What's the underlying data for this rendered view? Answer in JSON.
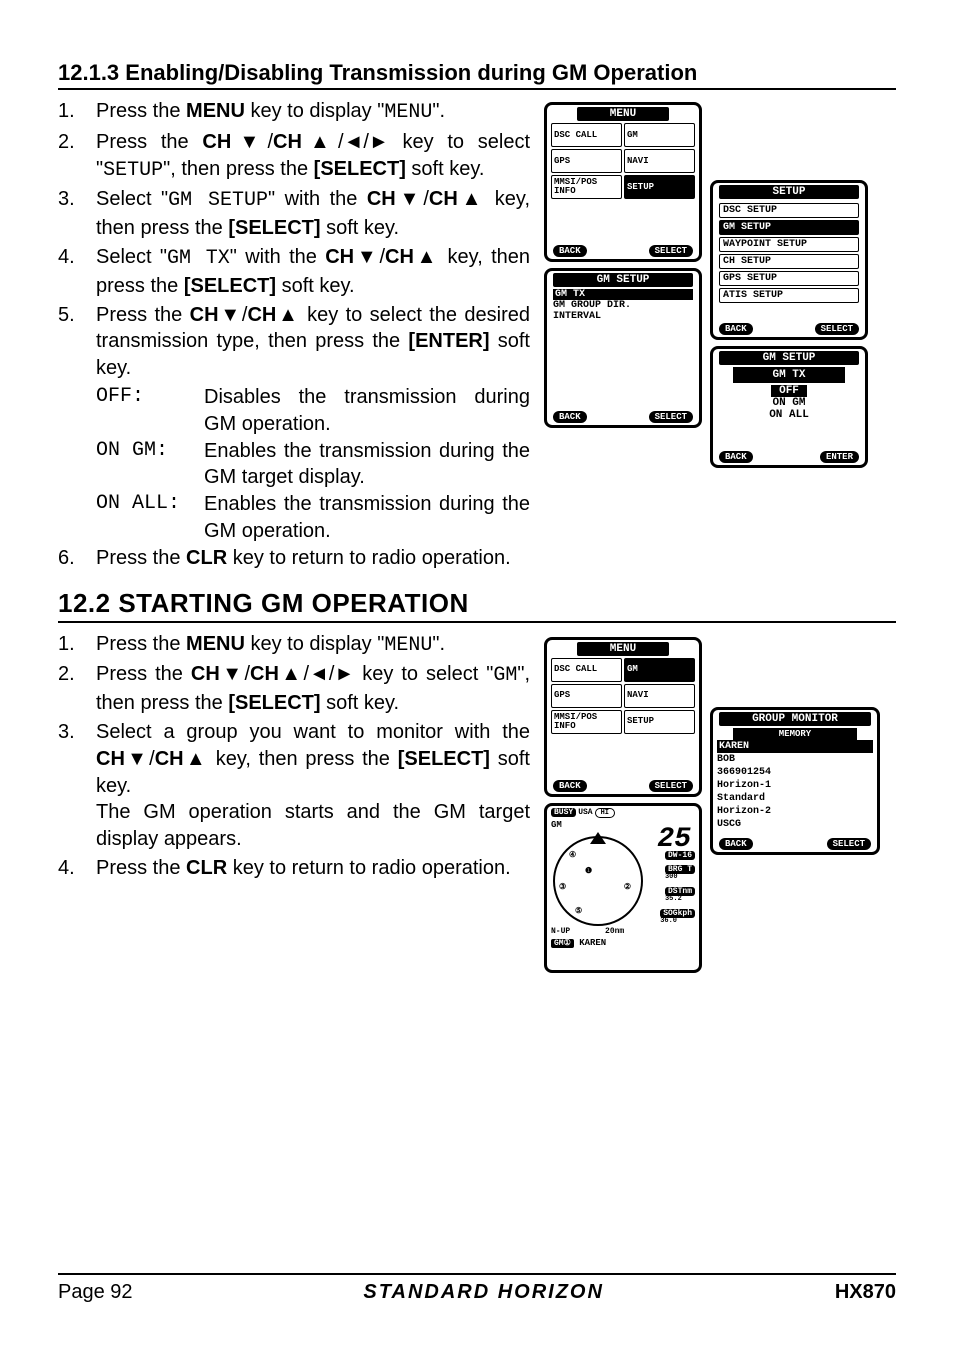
{
  "section1": {
    "heading": "12.1.3  Enabling/Disabling Transmission during GM Operation",
    "steps": [
      {
        "num": "1.",
        "segments": [
          {
            "t": "Press the "
          },
          {
            "t": "MENU",
            "b": true
          },
          {
            "t": " key to display \""
          },
          {
            "t": "MENU",
            "m": true
          },
          {
            "t": "\"."
          }
        ]
      },
      {
        "num": "2.",
        "segments": [
          {
            "t": "Press the "
          },
          {
            "t": "CH▼",
            "b": true
          },
          {
            "t": "/"
          },
          {
            "t": "CH▲",
            "b": true
          },
          {
            "t": "/"
          },
          {
            "t": "◄",
            "b": true
          },
          {
            "t": "/"
          },
          {
            "t": "►",
            "b": true
          },
          {
            "t": " key to select \""
          },
          {
            "t": "SETUP",
            "m": true
          },
          {
            "t": "\", then press the "
          },
          {
            "t": "[SELECT]",
            "b": true
          },
          {
            "t": " soft key."
          }
        ]
      },
      {
        "num": "3.",
        "segments": [
          {
            "t": "Select \""
          },
          {
            "t": "GM SETUP",
            "m": true
          },
          {
            "t": "\" with the "
          },
          {
            "t": "CH▼",
            "b": true
          },
          {
            "t": "/"
          },
          {
            "t": "CH▲",
            "b": true
          },
          {
            "t": " key, then press the "
          },
          {
            "t": "[SELECT]",
            "b": true
          },
          {
            "t": " soft key."
          }
        ]
      },
      {
        "num": "4.",
        "segments": [
          {
            "t": "Select \""
          },
          {
            "t": "GM TX",
            "m": true
          },
          {
            "t": "\" with the "
          },
          {
            "t": "CH▼",
            "b": true
          },
          {
            "t": "/"
          },
          {
            "t": "CH▲",
            "b": true
          },
          {
            "t": " key, then press the "
          },
          {
            "t": "[SELECT]",
            "b": true
          },
          {
            "t": " soft key."
          }
        ]
      },
      {
        "num": "5.",
        "segments": [
          {
            "t": "Press the "
          },
          {
            "t": "CH▼",
            "b": true
          },
          {
            "t": "/"
          },
          {
            "t": "CH▲",
            "b": true
          },
          {
            "t": " key to select the desired transmission type, then press the "
          },
          {
            "t": "[ENTER]",
            "b": true
          },
          {
            "t": " soft key."
          }
        ]
      }
    ],
    "defs": [
      {
        "key": "OFF:",
        "val": "Disables the transmission during GM operation."
      },
      {
        "key": "ON GM:",
        "val": "Enables the transmission during the GM target display."
      },
      {
        "key": "ON ALL:",
        "val": "Enables the transmission during the GM operation."
      }
    ],
    "step6": {
      "num": "6.",
      "segments": [
        {
          "t": "Press the "
        },
        {
          "t": "CLR",
          "b": true
        },
        {
          "t": " key to return to radio operation."
        }
      ]
    }
  },
  "section2": {
    "heading": "12.2  STARTING GM OPERATION",
    "steps": [
      {
        "num": "1.",
        "segments": [
          {
            "t": "Press the "
          },
          {
            "t": "MENU",
            "b": true
          },
          {
            "t": " key to display \""
          },
          {
            "t": "MENU",
            "m": true
          },
          {
            "t": "\"."
          }
        ]
      },
      {
        "num": "2.",
        "segments": [
          {
            "t": "Press the "
          },
          {
            "t": "CH▼",
            "b": true
          },
          {
            "t": "/"
          },
          {
            "t": "CH▲",
            "b": true
          },
          {
            "t": "/"
          },
          {
            "t": "◄",
            "b": true
          },
          {
            "t": "/"
          },
          {
            "t": "►",
            "b": true
          },
          {
            "t": " key to select \""
          },
          {
            "t": "GM",
            "m": true
          },
          {
            "t": "\", then press the "
          },
          {
            "t": "[SELECT]",
            "b": true
          },
          {
            "t": " soft key."
          }
        ]
      },
      {
        "num": "3.",
        "segments": [
          {
            "t": "Select a group you want to monitor with the "
          },
          {
            "t": "CH▼",
            "b": true
          },
          {
            "t": "/"
          },
          {
            "t": "CH▲",
            "b": true
          },
          {
            "t": " key, then press the "
          },
          {
            "t": "[SELECT]",
            "b": true
          },
          {
            "t": " soft key."
          }
        ],
        "tail": "The GM operation starts and the GM target display appears."
      },
      {
        "num": "4.",
        "segments": [
          {
            "t": "Press the "
          },
          {
            "t": "CLR",
            "b": true
          },
          {
            "t": " key to return to radio operation."
          }
        ]
      }
    ]
  },
  "lcd": {
    "menu": {
      "title": "MENU",
      "cells": [
        "DSC CALL",
        "GM",
        "GPS",
        "NAVI",
        "MMSI/POS INFO",
        "SETUP"
      ],
      "back": "BACK",
      "select": "SELECT"
    },
    "setup": {
      "title": "SETUP",
      "items": [
        "DSC SETUP",
        "GM SETUP",
        "WAYPOINT SETUP",
        "CH SETUP",
        "GPS SETUP",
        "ATIS SETUP"
      ],
      "selected": 1,
      "back": "BACK",
      "select": "SELECT"
    },
    "gmsetup": {
      "title": "GM SETUP",
      "items": [
        "GM TX",
        "GM GROUP DIR.",
        "INTERVAL"
      ],
      "selected": 0,
      "back": "BACK",
      "select": "SELECT"
    },
    "gmtx": {
      "title": "GM SETUP",
      "sub": "GM TX",
      "opts": [
        "OFF",
        "ON GM",
        "ON ALL"
      ],
      "selected": 0,
      "back": "BACK",
      "enter": "ENTER"
    },
    "menu2": {
      "title": "MENU",
      "cells": [
        "DSC CALL",
        "GM",
        "GPS",
        "NAVI",
        "MMSI/POS INFO",
        "SETUP"
      ],
      "back": "BACK",
      "select": "SELECT"
    },
    "gmtarget": {
      "busy": "BUSY",
      "usa": "USA",
      "gm": "GM",
      "ch": "25",
      "dw": "DW-16",
      "brg_l": "BRG T",
      "brg": "300",
      "dst_l": "DSTnm",
      "dst": "35.2",
      "sog_l": "SOGkph",
      "sog": "36.0",
      "nup": "N-UP",
      "range": "20nm",
      "gmlabel": "GM①",
      "name": "KAREN"
    },
    "groupmon": {
      "title": "GROUP MONITOR",
      "sub": "MEMORY",
      "items": [
        "KAREN",
        "BOB",
        "366901254",
        "Horizon-1",
        "Standard",
        "Horizon-2",
        "USCG"
      ],
      "selected": 0,
      "back": "BACK",
      "select": "SELECT"
    }
  },
  "footer": {
    "page": "Page 92",
    "brand": "STANDARD HORIZON",
    "model": "HX870"
  }
}
